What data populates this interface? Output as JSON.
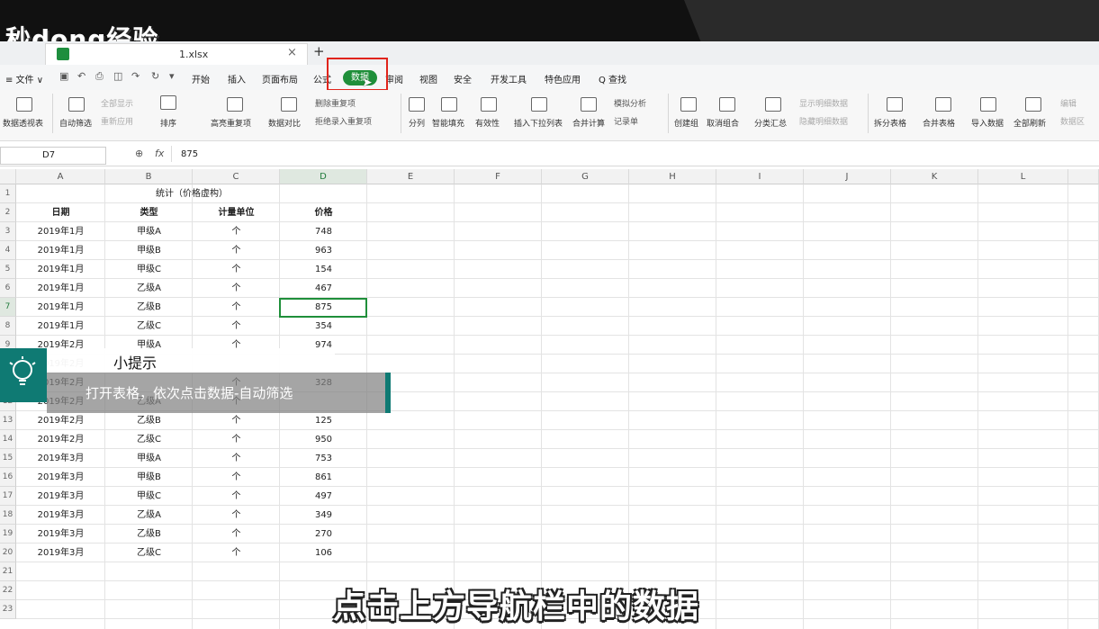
{
  "watermark": "秒dong经验",
  "tab": {
    "file_name": "1.xlsx",
    "close": "×",
    "add": "+"
  },
  "menu": {
    "file": "≡ 文件 ∨",
    "items": [
      "开始",
      "插入",
      "页面布局",
      "公式",
      "数据",
      "审阅",
      "视图",
      "安全",
      "开发工具",
      "特色应用",
      "Q 查找"
    ]
  },
  "ribbon": {
    "pivot": "数据透视表",
    "autofilter": "自动筛选",
    "show_all": "全部显示",
    "reapply": "重新应用",
    "sort": "排序",
    "highlight_dup": "高亮重复项",
    "compare": "数据对比",
    "remove_dup": "删除重复项",
    "reject_dup": "拒绝录入重复项",
    "split": "分列",
    "fill": "智能填充",
    "validity": "有效性",
    "dropdown": "插入下拉列表",
    "consolidate": "合并计算",
    "simulate": "模拟分析",
    "record": "记录单",
    "create_group": "创建组",
    "ungroup": "取消组合",
    "subtotal": "分类汇总",
    "show_detail": "显示明细数据",
    "hide_detail": "隐藏明细数据",
    "split_table": "拆分表格",
    "merge_table": "合并表格",
    "import": "导入数据",
    "refresh": "全部刷新",
    "edit_link": "编辑",
    "data_area": "数据区"
  },
  "formula_bar": {
    "cell_ref": "D7",
    "fx": "fx",
    "value": "875"
  },
  "columns": [
    "A",
    "B",
    "C",
    "D",
    "E",
    "F",
    "G",
    "H",
    "I",
    "J",
    "K",
    "L"
  ],
  "rows": [
    "1",
    "2",
    "3",
    "4",
    "5",
    "6",
    "7",
    "8",
    "9",
    "10",
    "11",
    "12",
    "13",
    "14",
    "15",
    "16",
    "17",
    "18",
    "19",
    "20",
    "21",
    "22",
    "23"
  ],
  "sheet": {
    "title": "统计（价格虚构）",
    "headers": [
      "日期",
      "类型",
      "计量单位",
      "价格"
    ],
    "data": [
      [
        "2019年1月",
        "甲级A",
        "个",
        "748"
      ],
      [
        "2019年1月",
        "甲级B",
        "个",
        "963"
      ],
      [
        "2019年1月",
        "甲级C",
        "个",
        "154"
      ],
      [
        "2019年1月",
        "乙级A",
        "个",
        "467"
      ],
      [
        "2019年1月",
        "乙级B",
        "个",
        "875"
      ],
      [
        "2019年1月",
        "乙级C",
        "个",
        "354"
      ],
      [
        "2019年2月",
        "甲级A",
        "个",
        "974"
      ],
      [
        "2019年2月",
        "",
        "",
        ""
      ],
      [
        "2019年2月",
        "",
        "个",
        "328"
      ],
      [
        "2019年2月",
        "乙级A",
        "个",
        ""
      ],
      [
        "2019年2月",
        "乙级B",
        "个",
        "125"
      ],
      [
        "2019年2月",
        "乙级C",
        "个",
        "950"
      ],
      [
        "2019年3月",
        "甲级A",
        "个",
        "753"
      ],
      [
        "2019年3月",
        "甲级B",
        "个",
        "861"
      ],
      [
        "2019年3月",
        "甲级C",
        "个",
        "497"
      ],
      [
        "2019年3月",
        "乙级A",
        "个",
        "349"
      ],
      [
        "2019年3月",
        "乙级B",
        "个",
        "270"
      ],
      [
        "2019年3月",
        "乙级C",
        "个",
        "106"
      ]
    ]
  },
  "tip": {
    "title": "小提示",
    "body": "打开表格，依次点击数据-自动筛选"
  },
  "subtitle": "点击上方导航栏中的数据",
  "colors": {
    "accent": "#1f8f3a",
    "tip": "#0f7a73",
    "highlight": "#e0241b"
  }
}
